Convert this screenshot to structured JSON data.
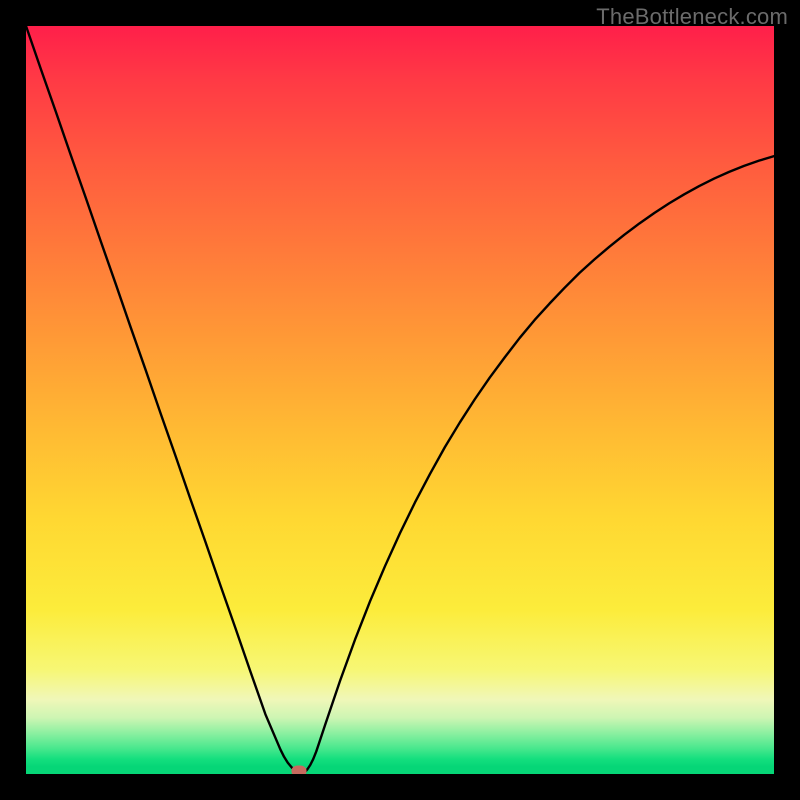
{
  "watermark": "TheBottleneck.com",
  "chart_data": {
    "type": "line",
    "title": "",
    "xlabel": "",
    "ylabel": "",
    "xlim": [
      0,
      1
    ],
    "ylim": [
      0,
      1
    ],
    "grid": false,
    "legend": false,
    "min_marker": {
      "x": 0.365,
      "y": 0.0
    },
    "series": [
      {
        "name": "curve",
        "x": [
          0.0,
          0.02,
          0.04,
          0.06,
          0.08,
          0.1,
          0.12,
          0.14,
          0.16,
          0.18,
          0.2,
          0.22,
          0.24,
          0.26,
          0.28,
          0.3,
          0.32,
          0.34,
          0.345,
          0.35,
          0.355,
          0.36,
          0.365,
          0.368,
          0.372,
          0.376,
          0.38,
          0.384,
          0.388,
          0.392,
          0.4,
          0.42,
          0.44,
          0.46,
          0.48,
          0.5,
          0.52,
          0.54,
          0.56,
          0.58,
          0.6,
          0.62,
          0.64,
          0.66,
          0.68,
          0.7,
          0.72,
          0.74,
          0.76,
          0.78,
          0.8,
          0.82,
          0.84,
          0.86,
          0.88,
          0.9,
          0.92,
          0.94,
          0.96,
          0.98,
          1.0
        ],
        "y": [
          1.0,
          0.942,
          0.885,
          0.827,
          0.77,
          0.712,
          0.655,
          0.597,
          0.54,
          0.482,
          0.425,
          0.367,
          0.31,
          0.252,
          0.195,
          0.137,
          0.08,
          0.033,
          0.023,
          0.015,
          0.009,
          0.004,
          0.0,
          0.0,
          0.002,
          0.006,
          0.012,
          0.02,
          0.03,
          0.042,
          0.066,
          0.125,
          0.18,
          0.231,
          0.278,
          0.322,
          0.363,
          0.401,
          0.437,
          0.47,
          0.501,
          0.53,
          0.557,
          0.583,
          0.607,
          0.629,
          0.65,
          0.67,
          0.688,
          0.705,
          0.721,
          0.736,
          0.75,
          0.763,
          0.775,
          0.786,
          0.796,
          0.805,
          0.813,
          0.82,
          0.826
        ]
      }
    ]
  }
}
